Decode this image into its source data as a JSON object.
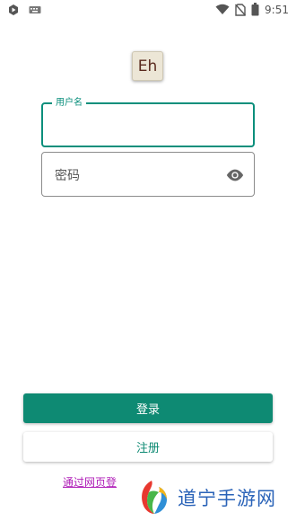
{
  "status_bar": {
    "time": "9:51",
    "icons": [
      "play-protect-icon",
      "keyboard-icon",
      "wifi-icon",
      "no-sim-icon",
      "battery-icon"
    ]
  },
  "app": {
    "logo_text": "Eh"
  },
  "form": {
    "username_label": "用户名",
    "username_value": "",
    "password_placeholder": "密码",
    "password_toggle_icon": "eye-icon"
  },
  "actions": {
    "login_label": "登录",
    "register_label": "注册",
    "web_login_link": "通过网页登"
  },
  "watermark": {
    "text": "道宁手游网"
  },
  "colors": {
    "accent": "#0e8a73",
    "link": "#b01fb8",
    "watermark_text": "#2a63b8"
  }
}
